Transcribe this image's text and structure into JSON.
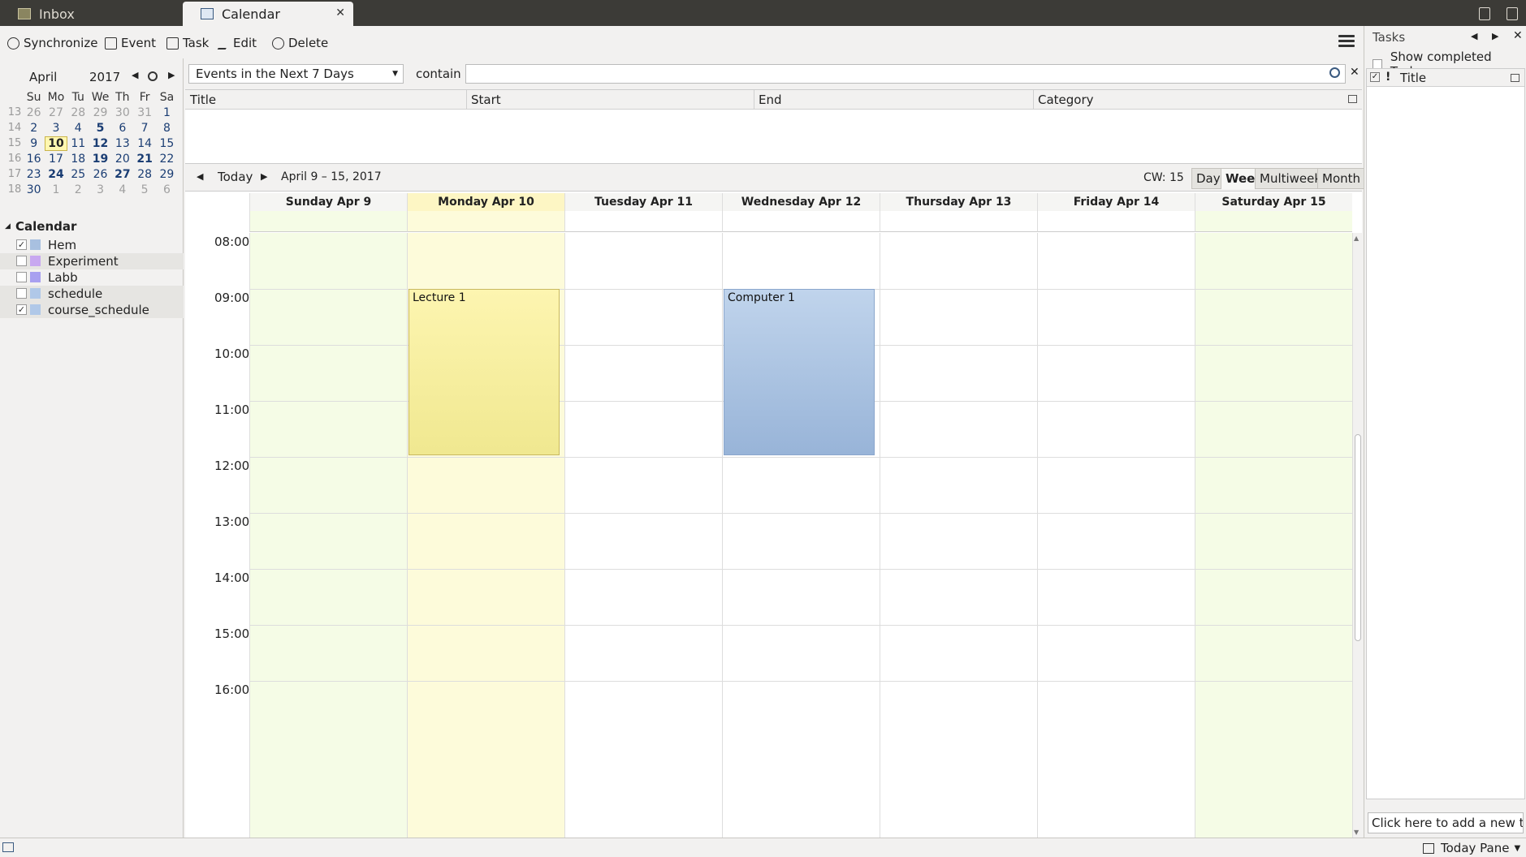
{
  "tabs": [
    {
      "label": "Inbox",
      "active": false
    },
    {
      "label": "Calendar",
      "active": true
    }
  ],
  "toolbar": {
    "synchronize": "Synchronize",
    "event": "Event",
    "task": "Task",
    "edit": "Edit",
    "delete": "Delete"
  },
  "minimonth": {
    "month": "April",
    "year": "2017",
    "day_headers": [
      "Su",
      "Mo",
      "Tu",
      "We",
      "Th",
      "Fr",
      "Sa"
    ],
    "weeks": [
      {
        "wk": "13",
        "days": [
          {
            "d": "26",
            "t": "other"
          },
          {
            "d": "27",
            "t": "other"
          },
          {
            "d": "28",
            "t": "other"
          },
          {
            "d": "29",
            "t": "other"
          },
          {
            "d": "30",
            "t": "other"
          },
          {
            "d": "31",
            "t": "other"
          },
          {
            "d": "1",
            "t": "cur"
          }
        ]
      },
      {
        "wk": "14",
        "days": [
          {
            "d": "2",
            "t": "cur"
          },
          {
            "d": "3",
            "t": "cur"
          },
          {
            "d": "4",
            "t": "cur"
          },
          {
            "d": "5",
            "t": "bold"
          },
          {
            "d": "6",
            "t": "cur"
          },
          {
            "d": "7",
            "t": "cur"
          },
          {
            "d": "8",
            "t": "cur"
          }
        ]
      },
      {
        "wk": "15",
        "days": [
          {
            "d": "9",
            "t": "cur"
          },
          {
            "d": "10",
            "t": "today"
          },
          {
            "d": "11",
            "t": "cur"
          },
          {
            "d": "12",
            "t": "bold"
          },
          {
            "d": "13",
            "t": "cur"
          },
          {
            "d": "14",
            "t": "cur"
          },
          {
            "d": "15",
            "t": "cur"
          }
        ]
      },
      {
        "wk": "16",
        "days": [
          {
            "d": "16",
            "t": "cur"
          },
          {
            "d": "17",
            "t": "cur"
          },
          {
            "d": "18",
            "t": "cur"
          },
          {
            "d": "19",
            "t": "bold"
          },
          {
            "d": "20",
            "t": "cur"
          },
          {
            "d": "21",
            "t": "bold"
          },
          {
            "d": "22",
            "t": "cur"
          }
        ]
      },
      {
        "wk": "17",
        "days": [
          {
            "d": "23",
            "t": "cur"
          },
          {
            "d": "24",
            "t": "bold"
          },
          {
            "d": "25",
            "t": "cur"
          },
          {
            "d": "26",
            "t": "cur"
          },
          {
            "d": "27",
            "t": "bold"
          },
          {
            "d": "28",
            "t": "cur"
          },
          {
            "d": "29",
            "t": "cur"
          }
        ]
      },
      {
        "wk": "18",
        "days": [
          {
            "d": "30",
            "t": "cur"
          },
          {
            "d": "1",
            "t": "other"
          },
          {
            "d": "2",
            "t": "other"
          },
          {
            "d": "3",
            "t": "other"
          },
          {
            "d": "4",
            "t": "other"
          },
          {
            "d": "5",
            "t": "other"
          },
          {
            "d": "6",
            "t": "other"
          }
        ]
      }
    ]
  },
  "calendars": {
    "heading": "Calendar",
    "items": [
      {
        "name": "Hem",
        "checked": true,
        "color": "#a8c0e0"
      },
      {
        "name": "Experiment",
        "checked": false,
        "color": "#c8a8f0"
      },
      {
        "name": "Labb",
        "checked": false,
        "color": "#a8a0f0"
      },
      {
        "name": "schedule",
        "checked": false,
        "color": "#b0c8e8"
      },
      {
        "name": "course_schedule",
        "checked": true,
        "color": "#b0c8e8"
      }
    ]
  },
  "filter": {
    "selected": "Events in the Next 7 Days",
    "contain_label": "contain",
    "search_value": ""
  },
  "unifinder": {
    "columns": [
      "Title",
      "Start",
      "End",
      "Category"
    ]
  },
  "nav": {
    "today": "Today",
    "range": "April 9 – 15, 2017",
    "cw": "CW: 15",
    "views": [
      "Day",
      "Week",
      "Multiweek",
      "Month"
    ],
    "selected_view": "Week"
  },
  "week": {
    "days": [
      {
        "label": "Sunday Apr 9",
        "weekend": true,
        "today": false
      },
      {
        "label": "Monday Apr 10",
        "weekend": false,
        "today": true
      },
      {
        "label": "Tuesday Apr 11",
        "weekend": false,
        "today": false
      },
      {
        "label": "Wednesday Apr 12",
        "weekend": false,
        "today": false
      },
      {
        "label": "Thursday Apr 13",
        "weekend": false,
        "today": false
      },
      {
        "label": "Friday Apr 14",
        "weekend": false,
        "today": false
      },
      {
        "label": "Saturday Apr 15",
        "weekend": true,
        "today": false
      }
    ],
    "hours": [
      "08:00",
      "09:00",
      "10:00",
      "11:00",
      "12:00",
      "13:00",
      "14:00",
      "15:00",
      "16:00"
    ],
    "first_hour": 8,
    "events": [
      {
        "title": "Lecture 1",
        "day": 1,
        "start": 9,
        "end": 12,
        "colors": [
          "#fdf5b0",
          "#f0e890"
        ],
        "border": "#c8b860"
      },
      {
        "title": "Computer 1",
        "day": 3,
        "start": 9,
        "end": 12,
        "colors": [
          "#c0d4ec",
          "#98b4d8"
        ],
        "border": "#8aa6cc"
      }
    ],
    "colors": {
      "weekend": "#f5fce6",
      "today": "#fdfbda",
      "weekday": "#ffffff"
    }
  },
  "tasks": {
    "title": "Tasks",
    "show_completed": "Show completed Tasks",
    "column_title": "Title",
    "column_priority": "!",
    "new_task_placeholder": "Click here to add a new task"
  },
  "statusbar": {
    "today_pane": "Today Pane"
  }
}
